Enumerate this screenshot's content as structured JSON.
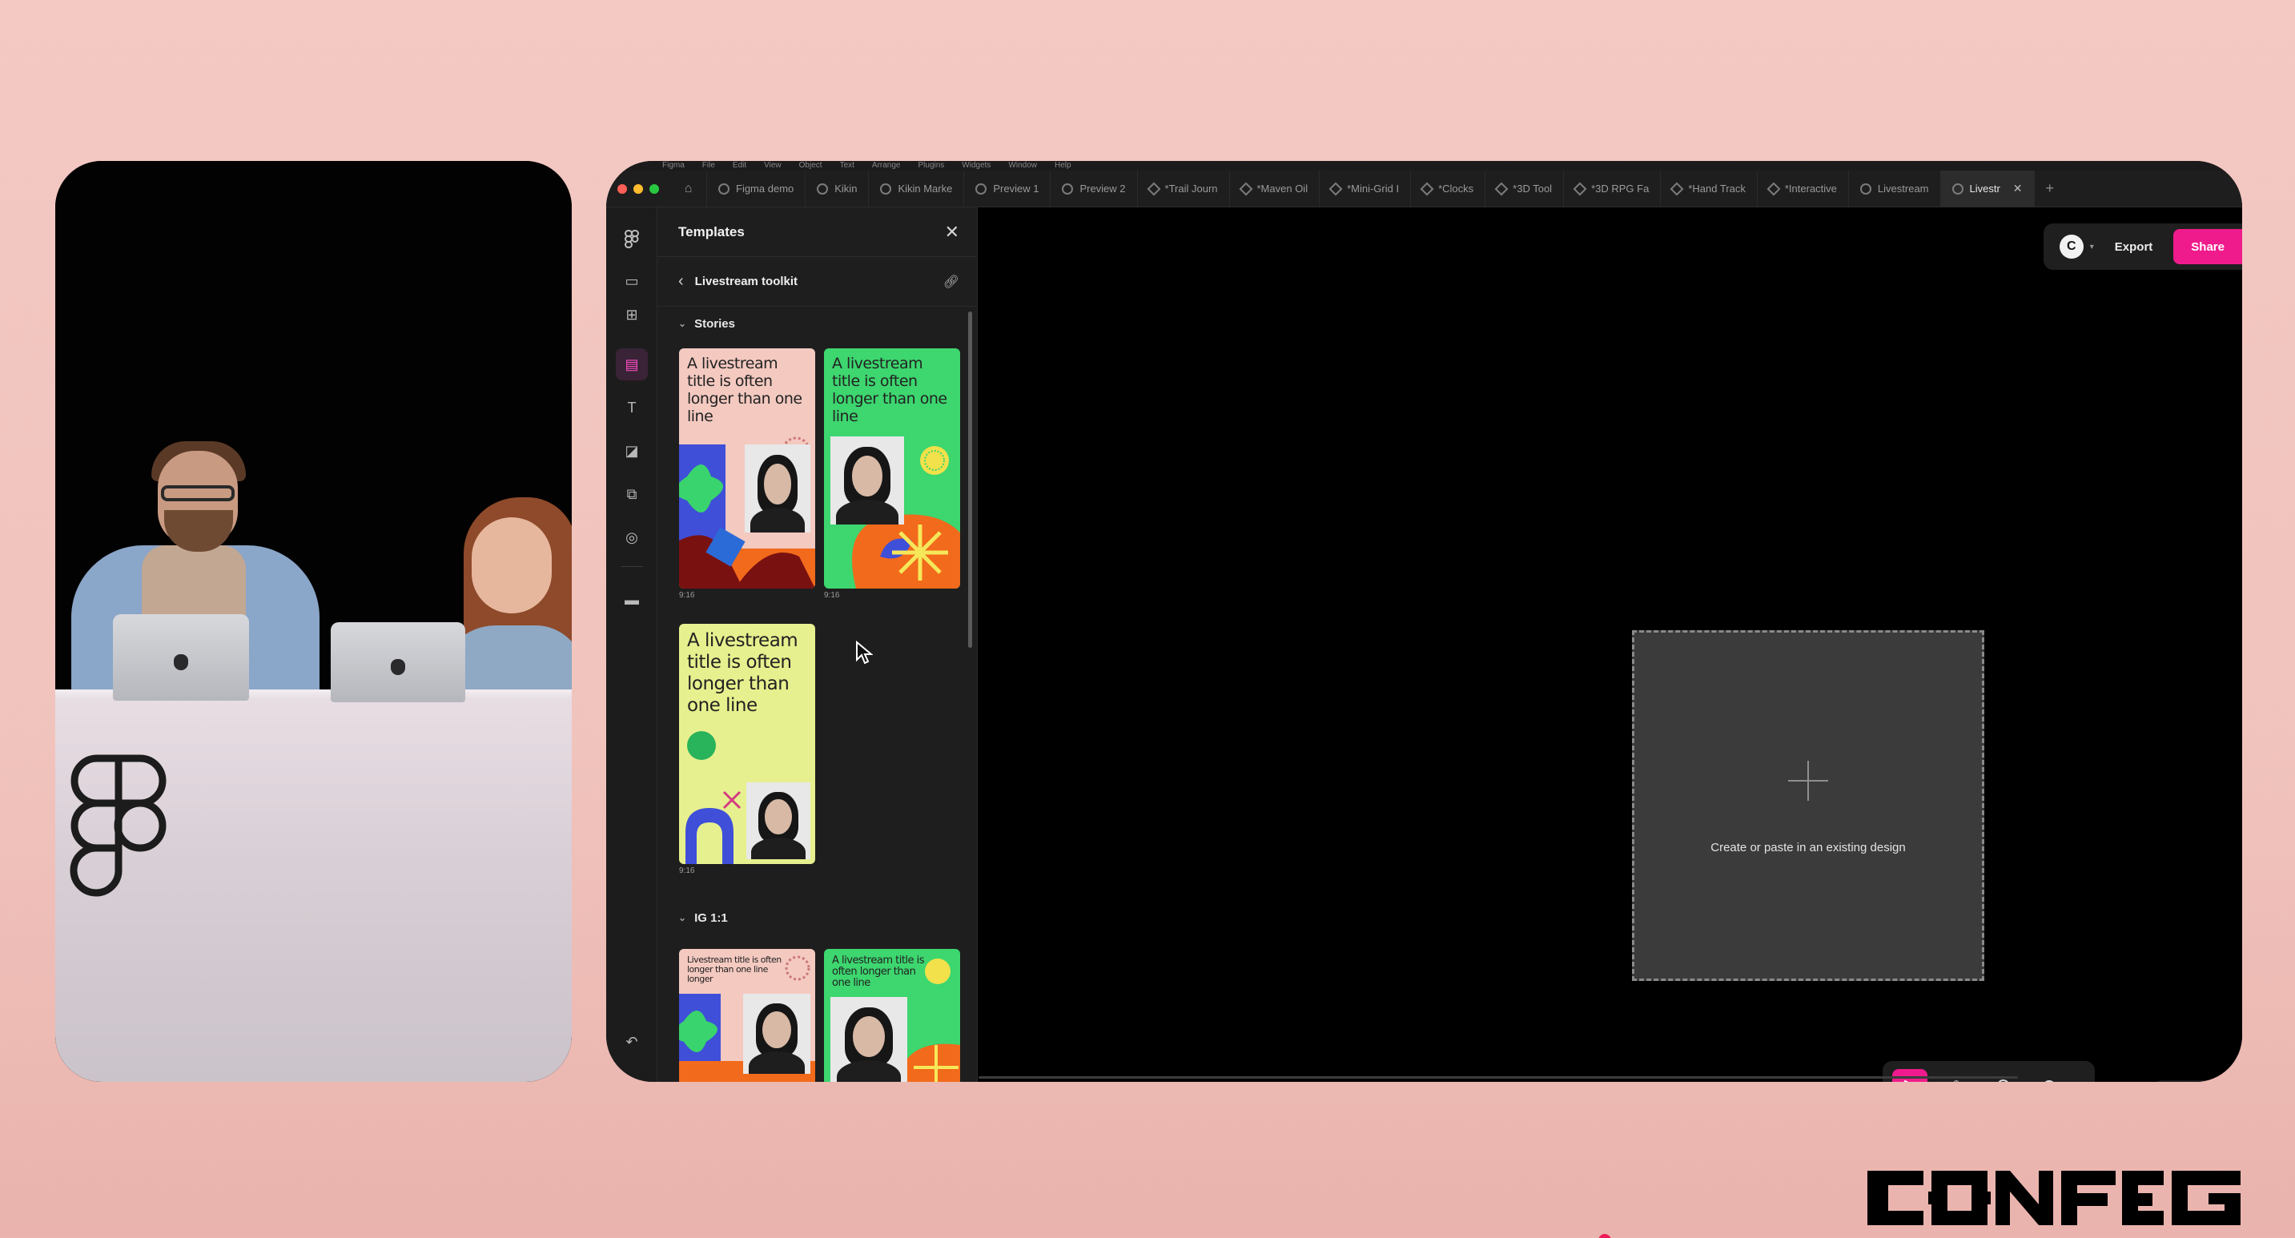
{
  "menubar": [
    "Figma",
    "File",
    "Edit",
    "View",
    "Object",
    "Text",
    "Arrange",
    "Plugins",
    "Widgets",
    "Window",
    "Help"
  ],
  "tabs": [
    {
      "label": "Figma demo",
      "icon": "circle"
    },
    {
      "label": "Kikin",
      "icon": "circle"
    },
    {
      "label": "Kikin Marke",
      "icon": "book"
    },
    {
      "label": "Preview 1",
      "icon": "circle"
    },
    {
      "label": "Preview 2",
      "icon": "circle"
    },
    {
      "label": "*Trail Journ",
      "icon": "diamond"
    },
    {
      "label": "*Maven Oil",
      "icon": "diamond"
    },
    {
      "label": "*Mini-Grid I",
      "icon": "diamond"
    },
    {
      "label": "*Clocks",
      "icon": "diamond"
    },
    {
      "label": "*3D Tool",
      "icon": "diamond"
    },
    {
      "label": "*3D RPG Fa",
      "icon": "diamond"
    },
    {
      "label": "*Hand Track",
      "icon": "diamond"
    },
    {
      "label": "*Interactive",
      "icon": "diamond"
    },
    {
      "label": "Livestream",
      "icon": "circle"
    },
    {
      "label": "Livestr",
      "icon": "pen",
      "active": true
    }
  ],
  "panel": {
    "title": "Templates",
    "close": "✕",
    "kit_name": "Livestream toolkit",
    "sections": {
      "stories": "Stories",
      "ig": "IG 1:1"
    },
    "cards": {
      "c1_title": "A livestream title is often longer than one line",
      "c2_title": "A livestream title is often longer than one line",
      "c3_title": "A livestream title is often longer than one line",
      "c4_title": "Livestream title is often longer than one line longer",
      "c5_title": "A livestream title is often longer than one line",
      "ratio_label": "9:16"
    }
  },
  "canvas": {
    "drop_text": "Create or paste in an existing design",
    "avatar_initial": "C",
    "export_label": "Export",
    "share_label": "Share",
    "zoom_out": "–",
    "zoom_in": "+",
    "help": "?"
  },
  "colors": {
    "accent": "#ef1b8c",
    "card_pink": "#f3c9c0",
    "card_green": "#3dd66f",
    "card_yellow": "#e7f08e",
    "card_orange": "#f26a1b"
  }
}
